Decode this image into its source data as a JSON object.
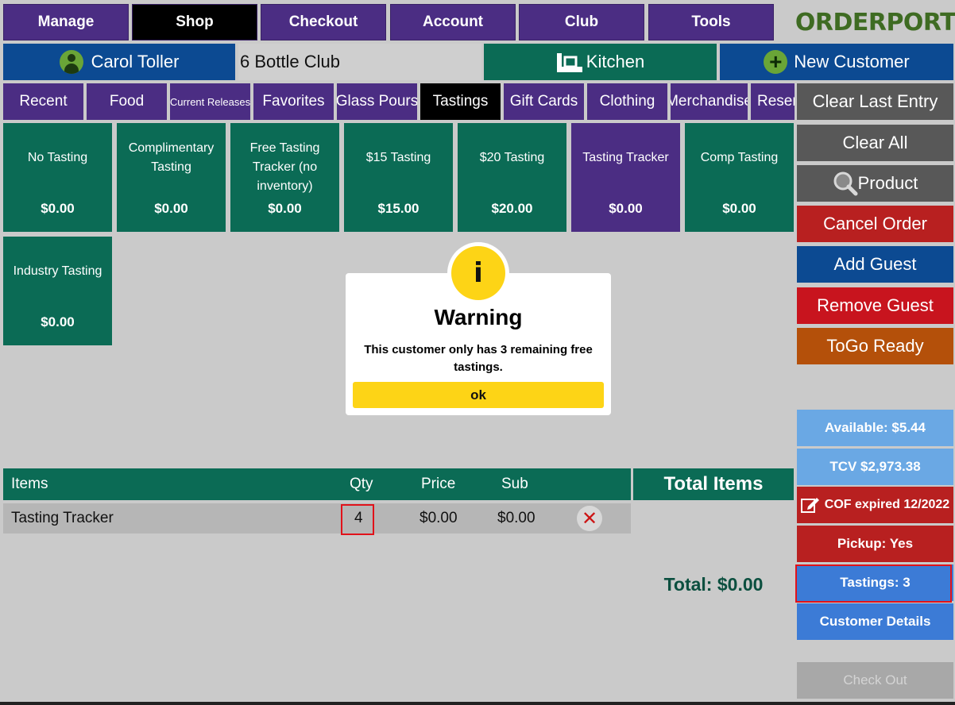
{
  "topnav": {
    "manage": "Manage",
    "shop": "Shop",
    "checkout": "Checkout",
    "account": "Account",
    "club": "Club",
    "tools": "Tools",
    "logo_text": "ORDERPORT"
  },
  "customer": {
    "name": "Carol Toller",
    "club": "6 Bottle Club",
    "kitchen": "Kitchen",
    "new_customer": "New Customer"
  },
  "categories": [
    "Recent",
    "Food",
    "Current Releases",
    "Favorites",
    "Glass Pours",
    "Tastings",
    "Gift Cards",
    "Clothing",
    "Merchandise",
    "Reserv"
  ],
  "products": [
    {
      "name": "No Tasting",
      "price": "$0.00"
    },
    {
      "name": "Complimentary Tasting",
      "price": "$0.00"
    },
    {
      "name": "Free Tasting Tracker (no inventory)",
      "price": "$0.00"
    },
    {
      "name": "$15 Tasting",
      "price": "$15.00"
    },
    {
      "name": "$20 Tasting",
      "price": "$20.00"
    },
    {
      "name": "Tasting Tracker",
      "price": "$0.00"
    },
    {
      "name": "Comp Tasting",
      "price": "$0.00"
    },
    {
      "name": "Industry Tasting",
      "price": "$0.00"
    }
  ],
  "actions": {
    "clear_last": "Clear Last Entry",
    "clear_all": "Clear All",
    "product": "Product",
    "cancel_order": "Cancel Order",
    "add_guest": "Add Guest",
    "remove_guest": "Remove Guest",
    "togo_ready": "ToGo Ready",
    "available": "Available: $5.44",
    "tcv": "TCV $2,973.38",
    "cof": "COF expired 12/2022",
    "pickup": "Pickup: Yes",
    "tastings": "Tastings: 3",
    "customer_details": "Customer Details",
    "check_out": "Check Out"
  },
  "items_table": {
    "headers": {
      "items": "Items",
      "qty": "Qty",
      "price": "Price",
      "sub": "Sub"
    },
    "rows": [
      {
        "name": "Tasting Tracker",
        "qty": "4",
        "price": "$0.00",
        "sub": "$0.00"
      }
    ]
  },
  "totals": {
    "header": "Total Items",
    "total": "Total: $0.00"
  },
  "modal": {
    "badge": "i",
    "title": "Warning",
    "message": "This customer only has 3 remaining free tastings.",
    "ok": "ok"
  },
  "colors": {
    "purple": "#4b2d83",
    "green": "#0b6b55",
    "blue": "#0c4a92",
    "red": "#b82020",
    "yellow": "#fdd416"
  }
}
